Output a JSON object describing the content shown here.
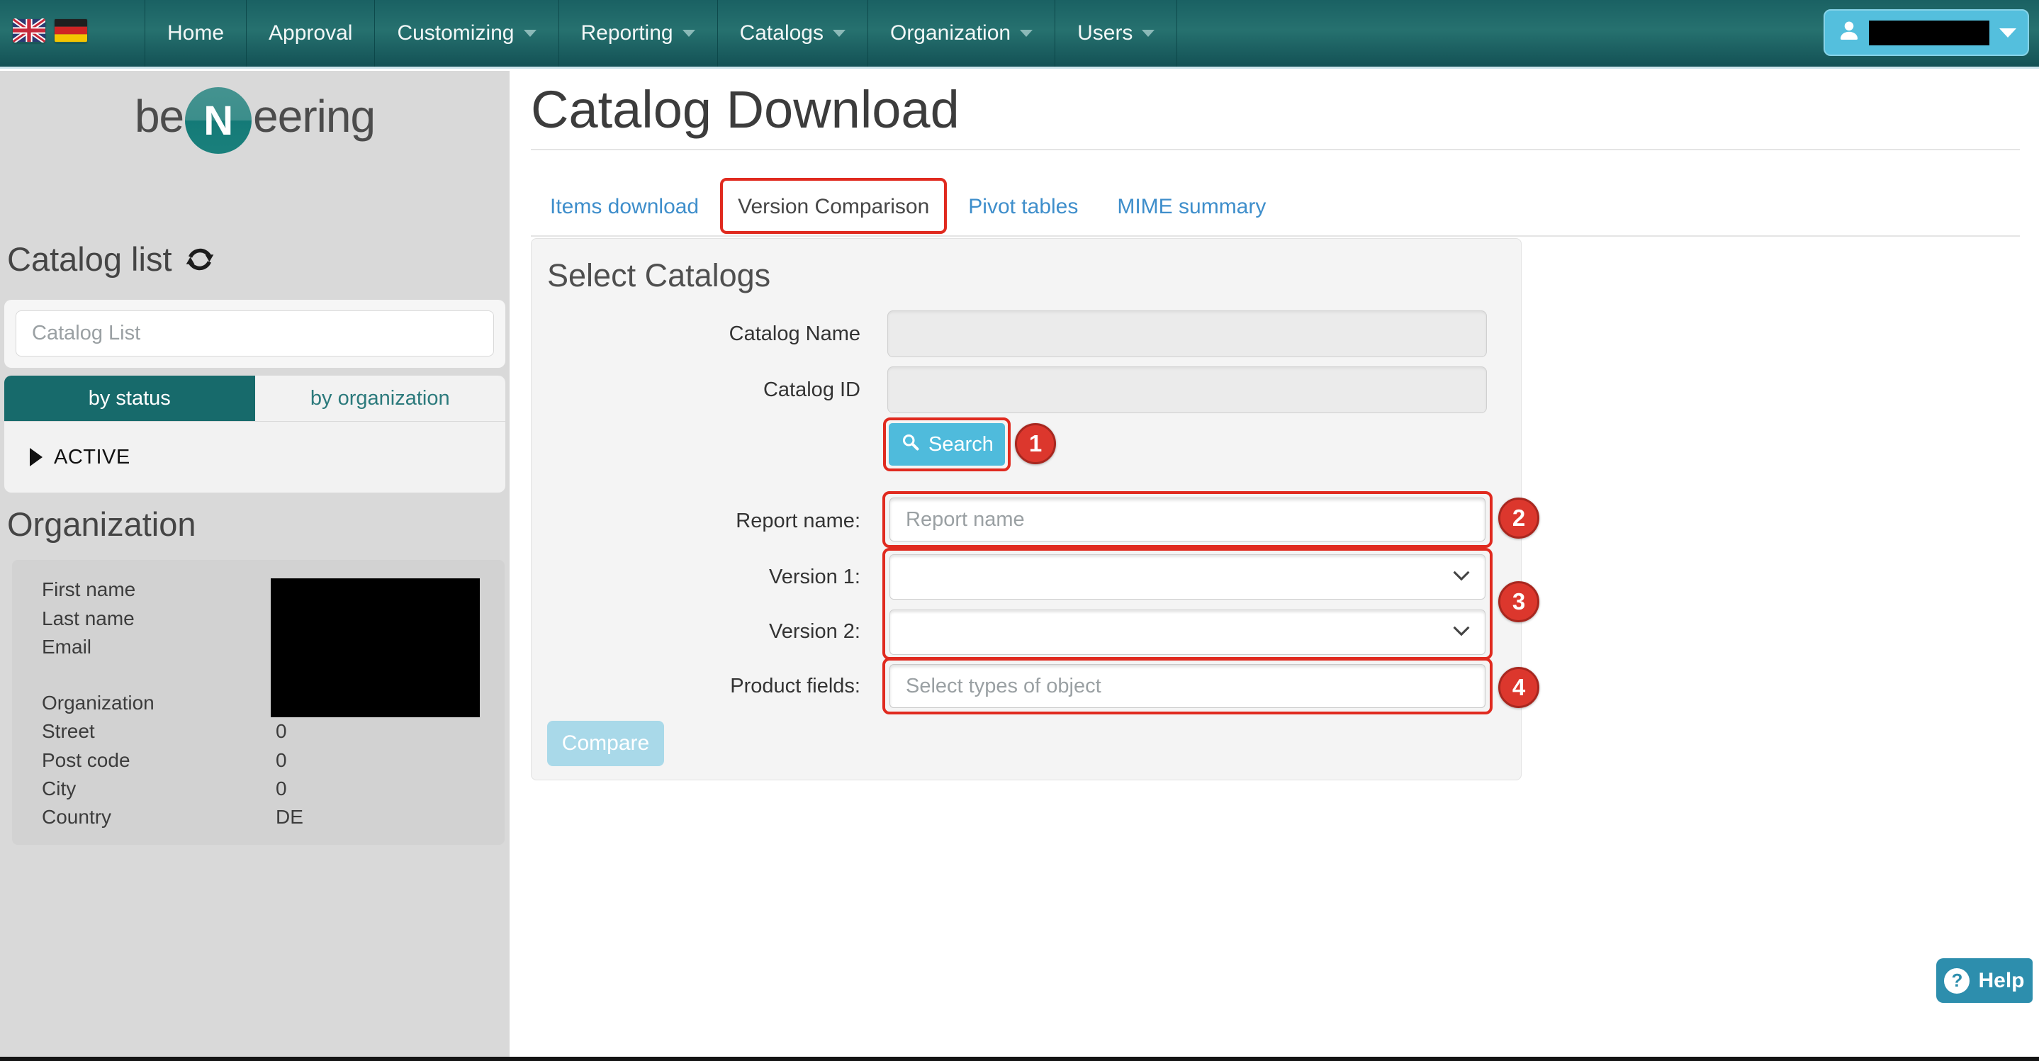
{
  "navbar": {
    "flags": [
      {
        "name": "uk-flag"
      },
      {
        "name": "germany-flag"
      }
    ],
    "items": [
      {
        "label": "Home"
      },
      {
        "label": "Approval"
      },
      {
        "label": "Customizing"
      },
      {
        "label": "Reporting"
      },
      {
        "label": "Catalogs"
      },
      {
        "label": "Organization"
      },
      {
        "label": "Users"
      }
    ]
  },
  "sidebar": {
    "logo": {
      "prefix": "be",
      "n": "N",
      "suffix": "eering"
    },
    "catalog_list_heading": "Catalog list",
    "catalog_list_placeholder": "Catalog List",
    "tabs": [
      {
        "label": "by status",
        "active": true
      },
      {
        "label": "by organization",
        "active": false
      }
    ],
    "status_item": "ACTIVE",
    "organization_heading": "Organization",
    "org_rows": [
      {
        "label": "First name",
        "value": ""
      },
      {
        "label": "Last name",
        "value": ""
      },
      {
        "label": "Email",
        "value": ""
      },
      {
        "label": "Organization",
        "value": ""
      },
      {
        "label": "Street",
        "value": "0"
      },
      {
        "label": "Post code",
        "value": "0"
      },
      {
        "label": "City",
        "value": "0"
      },
      {
        "label": "Country",
        "value": "DE"
      }
    ]
  },
  "main": {
    "title": "Catalog Download",
    "tabs": [
      {
        "label": "Items download",
        "active": false
      },
      {
        "label": "Version Comparison",
        "active": true,
        "annotated": true
      },
      {
        "label": "Pivot tables",
        "active": false
      },
      {
        "label": "MIME summary",
        "active": false
      }
    ],
    "form": {
      "heading": "Select Catalogs",
      "catalog_name_label": "Catalog Name",
      "catalog_id_label": "Catalog ID",
      "search_button": "Search",
      "report_name_label": "Report name:",
      "report_name_placeholder": "Report name",
      "version1_label": "Version 1:",
      "version2_label": "Version 2:",
      "product_fields_label": "Product fields:",
      "product_fields_placeholder": "Select types of object",
      "compare_button": "Compare"
    },
    "annotations": [
      {
        "number": "1"
      },
      {
        "number": "2"
      },
      {
        "number": "3"
      },
      {
        "number": "4"
      }
    ]
  },
  "help_button": {
    "label": "Help",
    "icon_glyph": "?"
  },
  "colors": {
    "navbar_teal": "#1d6b6d",
    "sidebar_tab_teal": "#176a6b",
    "link_blue": "#3e8ecb",
    "annotation_red": "#e02a1f",
    "search_blue": "#4fbbdc",
    "compare_blue": "#a9d9e9",
    "help_teal": "#2d8ead",
    "sidebar_gray": "#d9d9d9"
  }
}
